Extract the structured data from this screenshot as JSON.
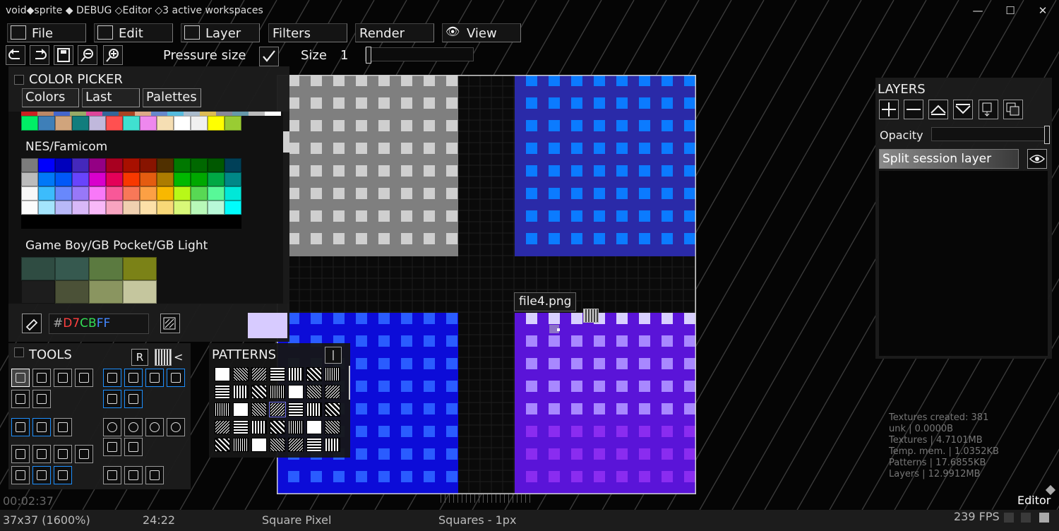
{
  "titlebar": {
    "title": "void◆sprite ◆ DEBUG  ◇Editor  ◇3 active workspaces",
    "minimize": "—",
    "maximize": "☐",
    "close": "✕"
  },
  "menu": {
    "file": "File",
    "edit": "Edit",
    "layer": "Layer",
    "filters": "Filters",
    "render": "Render",
    "view": "View"
  },
  "toolbar": {
    "pressure_label": "Pressure size",
    "pressure_checked": true,
    "size_label": "Size",
    "size_value": "1"
  },
  "color_picker": {
    "title": "COLOR PICKER",
    "tabs": [
      "Colors",
      "Last",
      "Palettes"
    ],
    "top_strip": [
      "#cc2222",
      "#bb8866",
      "#4466cc",
      "#99aa66",
      "#dd4499",
      "#336699",
      "#aa4422",
      "#ddaa88",
      "#6688cc",
      "#55bbdd",
      "#aabbcc",
      "#ddbb55",
      "#888899",
      "#6699aa",
      "#bbbbbb",
      "#ffffff"
    ],
    "top_row": [
      "#00ee66",
      "#3e7fb8",
      "#d0a47c",
      "#117d7d",
      "#c0b8dc",
      "#ff5050",
      "#40e0d0",
      "#ee88ee",
      "#f5deb3",
      "#ffffff",
      "#f0f0f0",
      "#ffff00",
      "#99cc33"
    ],
    "palettes": [
      {
        "name": "NES/Famicom",
        "rows": [
          [
            "#7c7c7c",
            "#0000fc",
            "#0000bc",
            "#4428bc",
            "#940084",
            "#a80020",
            "#a81000",
            "#881400",
            "#503000",
            "#007800",
            "#006800",
            "#005800",
            "#004058"
          ],
          [
            "#bcbcbc",
            "#0078f8",
            "#0058f8",
            "#6844fc",
            "#d800cc",
            "#e40058",
            "#f83800",
            "#e45c10",
            "#ac7c00",
            "#00b800",
            "#00a800",
            "#00a844",
            "#008888"
          ],
          [
            "#f8f8f8",
            "#3cbcfc",
            "#6888fc",
            "#9878f8",
            "#f878f8",
            "#f85898",
            "#f87858",
            "#fca044",
            "#f8b800",
            "#b8f818",
            "#58d854",
            "#58f898",
            "#00e8d8"
          ],
          [
            "#fcfcfc",
            "#a4e4fc",
            "#b8b8f8",
            "#d8b8f8",
            "#f8b8f8",
            "#f8a4c0",
            "#f0d0b0",
            "#fce0a8",
            "#f8d878",
            "#d8f878",
            "#b8f8b8",
            "#b8f8d8",
            "#00fcfc"
          ],
          [
            "#000000",
            "#000000",
            "#000000",
            "#000000",
            "#000000",
            "#000000",
            "#000000",
            "#000000",
            "#000000",
            "#000000",
            "#000000",
            "#000000",
            "#000000"
          ]
        ]
      },
      {
        "name": "Game Boy/GB Pocket/GB Light",
        "rows": [
          [
            "#2f4c42",
            "#36594f",
            "#5b7a40",
            "#7b8217"
          ],
          [
            "#1d1d1d",
            "#4b5137",
            "#8a9560",
            "#c5c69e"
          ]
        ]
      }
    ],
    "hex_prefix": "#",
    "hex_r": "D7",
    "hex_g": "CB",
    "hex_b": "FF",
    "current_color": "#D7CBFF"
  },
  "tools": {
    "title": "TOOLS",
    "r_label": "R",
    "arrow_label": "<"
  },
  "patterns": {
    "title": "PATTERNS",
    "cursor_label": "|"
  },
  "canvas": {
    "file_label": "file4.png"
  },
  "layers": {
    "title": "LAYERS",
    "opacity_label": "Opacity",
    "layer_name": "Split session layer"
  },
  "stats": {
    "lines": [
      "Textures created: 381",
      "unk | 0.0000B",
      "Textures | 4.7101MB",
      "Temp. mem. | 1.0352KB",
      "Patterns | 17.6855KB",
      "Layers | 12.9912MB"
    ]
  },
  "status": {
    "timer": "00:02:37",
    "dims": "37x37 (1600%)",
    "cursor": "24:22",
    "pixel_mode": "Square Pixel",
    "brush": "Squares - 1px",
    "fps": "239 FPS",
    "mode": "Editor"
  },
  "colors": {
    "accent": "#1e90ff",
    "quad_gray": "#7f7f7f",
    "quad_blue": "#2a2aa8",
    "quad_royal": "#0c0cd8",
    "quad_purple": "#5a14d8"
  },
  "icons": {
    "file": "image-icon",
    "edit": "adjust-icon",
    "layer": "layers-icon",
    "view": "eye-icon"
  }
}
